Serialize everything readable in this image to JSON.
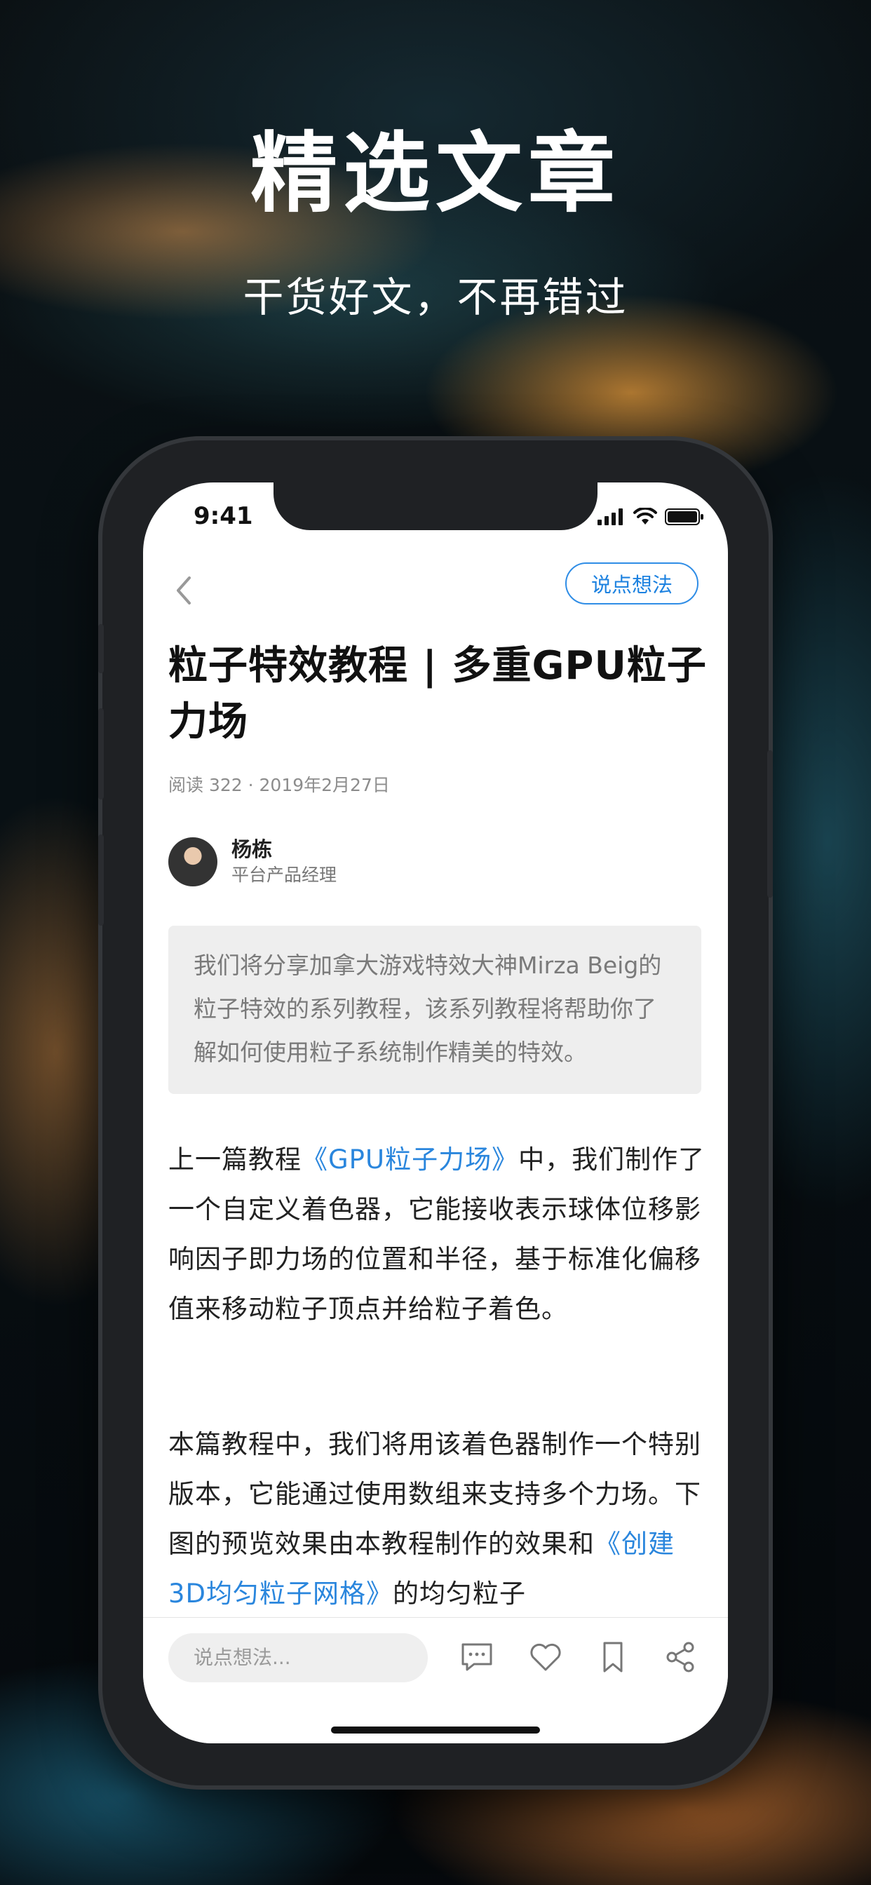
{
  "promo": {
    "title": "精选文章",
    "subtitle": "干货好文，不再错过"
  },
  "status_bar": {
    "time": "9:41",
    "icons": [
      "cellular-signal-icon",
      "wifi-icon",
      "battery-icon"
    ]
  },
  "nav": {
    "back_icon": "chevron-left-icon",
    "opinion_button": "说点想法"
  },
  "article": {
    "title": "粒子特效教程 | 多重GPU粒子力场",
    "meta": "阅读 322 · 2019年2月27日",
    "author": {
      "name": "杨栋",
      "role": "平台产品经理"
    },
    "summary": "我们将分享加拿大游戏特效大神Mirza Beig的粒子特效的系列教程，该系列教程将帮助你了解如何使用粒子系统制作精美的特效。",
    "para1": {
      "before": "上一篇教程",
      "link": "《GPU粒子力场》",
      "after": "中，我们制作了一个自定义着色器，它能接收表示球体位移影响因子即力场的位置和半径，基于标准化偏移值来移动粒子顶点并给粒子着色。"
    },
    "para2": {
      "before": "本篇教程中，我们将用该着色器制作一个特别版本，它能通过使用数组来支持多个力场。下图的预览效果由本教程制作的效果和",
      "link": "《创建3D均匀粒子网格》",
      "after": "的均匀粒子"
    }
  },
  "bottom_bar": {
    "comment_placeholder": "说点想法...",
    "icons": [
      "comment-icon",
      "like-heart-icon",
      "bookmark-icon",
      "share-icon"
    ]
  },
  "colors": {
    "accent_blue": "#2a86dd",
    "summary_bg": "#eeeeee",
    "frame": "#1f2124"
  }
}
